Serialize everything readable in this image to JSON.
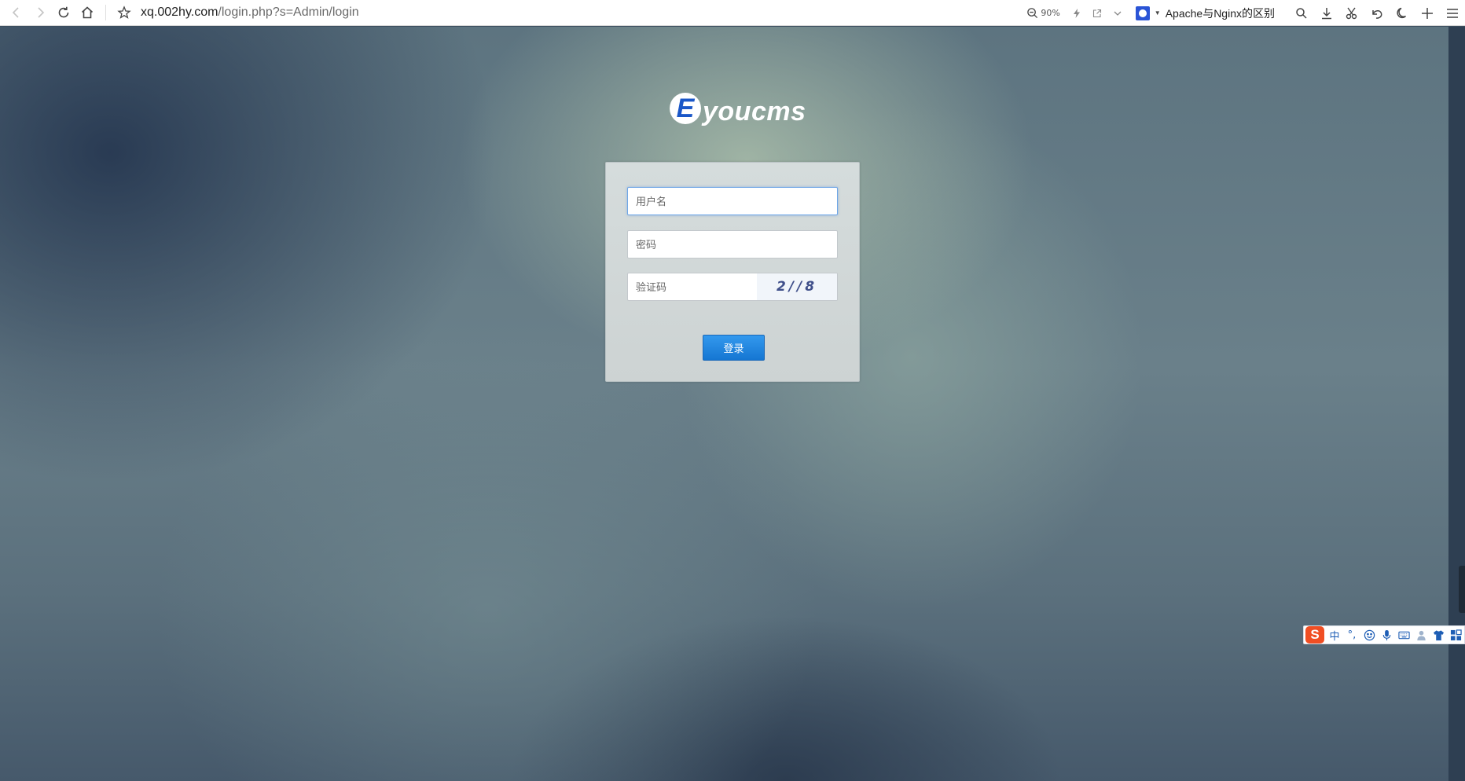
{
  "browser": {
    "url_host": "xq.002hy.com",
    "url_path": "/login.php?s=Admin/login",
    "zoom": "90%",
    "tab_hint": "Apache与Nginx的区别"
  },
  "logo": {
    "mark": "E",
    "text": "youcms"
  },
  "form": {
    "username_placeholder": "用户名",
    "password_placeholder": "密码",
    "captcha_placeholder": "验证码",
    "captcha_text": "2//8",
    "submit_label": "登录"
  },
  "ime": {
    "logo": "S",
    "mode": "中",
    "punct": "°,"
  },
  "colors": {
    "accent": "#1a7ad4",
    "logo_blue": "#1a57c8"
  }
}
